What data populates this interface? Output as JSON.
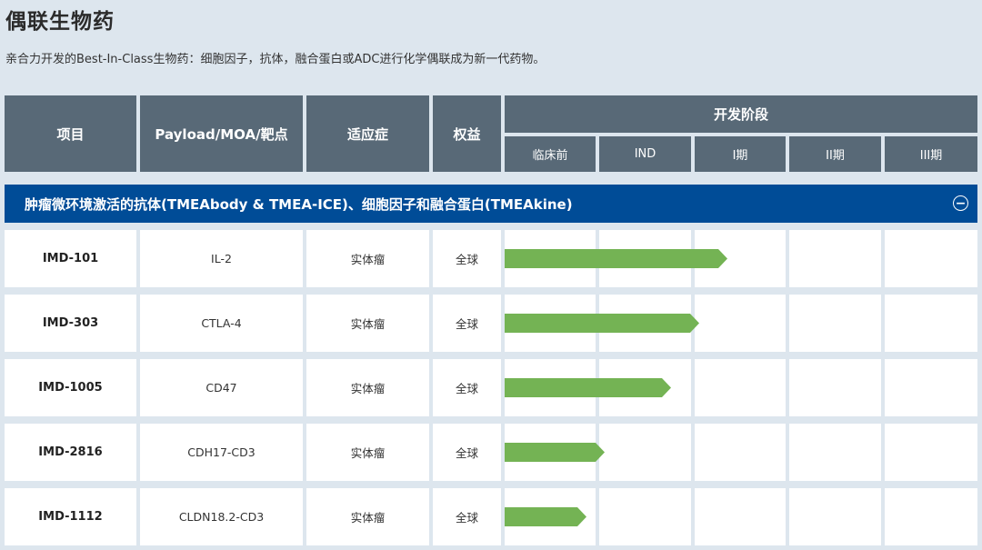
{
  "page": {
    "title": "偶联生物药",
    "subtitle": "亲合力开发的Best-In-Class生物药：细胞因子，抗体，融合蛋白或ADC进行化学偶联成为新一代药物。"
  },
  "table_header": {
    "project": "项目",
    "payload": "Payload/MOA/靶点",
    "indication": "适应症",
    "rights": "权益",
    "stage_group": "开发阶段",
    "stages": [
      "临床前",
      "IND",
      "I期",
      "II期",
      "III期"
    ]
  },
  "section": {
    "title": "肿瘤微环境激活的抗体(TMEAbody & TMEA-ICE)、细胞因子和融合蛋白(TMEAkine)",
    "collapse_icon": "minus-circle-icon",
    "collapse_symbol": "−"
  },
  "colors": {
    "header_bg": "#586977",
    "section_bg": "#004c97",
    "progress_bar": "#74b354",
    "page_bg": "#dde6ee"
  },
  "rows": [
    {
      "name": "IMD-101",
      "payload": "IL-2",
      "indication": "实体瘤",
      "rights": "全球",
      "progress_stage_fraction": 2.35
    },
    {
      "name": "IMD-303",
      "payload": "CTLA-4",
      "indication": "实体瘤",
      "rights": "全球",
      "progress_stage_fraction": 2.05
    },
    {
      "name": "IMD-1005",
      "payload": "CD47",
      "indication": "实体瘤",
      "rights": "全球",
      "progress_stage_fraction": 1.75
    },
    {
      "name": "IMD-2816",
      "payload": "CDH17-CD3",
      "indication": "实体瘤",
      "rights": "全球",
      "progress_stage_fraction": 1.06
    },
    {
      "name": "IMD-1112",
      "payload": "CLDN18.2-CD3",
      "indication": "实体瘤",
      "rights": "全球",
      "progress_stage_fraction": 0.87
    }
  ]
}
